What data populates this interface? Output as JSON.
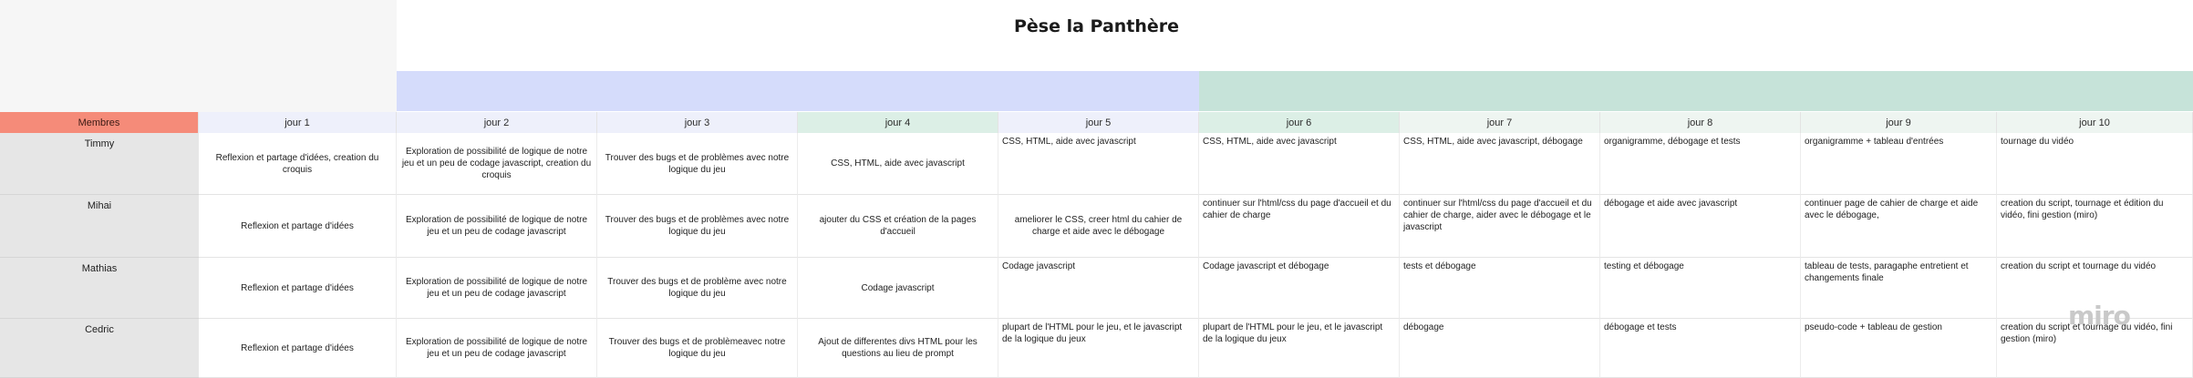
{
  "board": {
    "title": "Pèse la Panthère",
    "watermark": "miro"
  },
  "header": {
    "members_label": "Membres",
    "days": [
      "jour 1",
      "jour 2",
      "jour 3",
      "jour 4",
      "jour 5",
      "jour 6",
      "jour 7",
      "jour 8",
      "jour 9",
      "jour 10"
    ]
  },
  "colors": {
    "members_header": "#f58b79",
    "band_blue": "#d5dcfb",
    "band_green": "#c6e3d9"
  },
  "rows": [
    {
      "name": "Timmy",
      "cells": [
        "Reflexion et partage d'idées, creation du croquis",
        "Exploration de possibilité de logique de notre jeu et un peu de codage javascript, creation du croquis",
        "Trouver des bugs et de problèmes avec notre logique du jeu",
        "CSS, HTML, aide avec javascript",
        "CSS, HTML, aide avec javascript",
        "CSS, HTML, aide avec javascript",
        "CSS, HTML, aide avec javascript, débogage",
        "organigramme, débogage et tests",
        "organigramme + tableau d'entrées",
        "tournage du vidéo"
      ]
    },
    {
      "name": "Mihai",
      "cells": [
        "Reflexion et partage d'idées",
        "Exploration de possibilité de logique de notre jeu et un peu de codage javascript",
        "Trouver des bugs et de problèmes avec notre logique du jeu",
        "ajouter du CSS et création de la pages d'accueil",
        "ameliorer le CSS, creer html du cahier de charge et aide avec le débogage",
        "continuer sur l'html/css du page d'accueil et du cahier de charge",
        "continuer sur l'html/css du page d'accueil et du cahier de charge, aider avec le débogage et le javascript",
        "débogage et aide avec javascript",
        "continuer page de cahier de charge et aide avec le débogage,",
        "creation du script, tournage et édition du vidéo, fini gestion (miro)"
      ]
    },
    {
      "name": "Mathias",
      "cells": [
        "Reflexion et partage d'idées",
        "Exploration de possibilité de logique de notre jeu et un peu de codage javascript",
        "Trouver des bugs et de problème avec notre logique du jeu",
        "Codage javascript",
        "Codage javascript",
        "Codage javascript et débogage",
        "tests et débogage",
        "testing et débogage",
        "tableau de tests, paragaphe entretient et changements finale",
        "creation du script et tournage du vidéo"
      ]
    },
    {
      "name": "Cedric",
      "cells": [
        "Reflexion et partage d'idées",
        "Exploration de possibilité de logique de notre jeu et un peu de codage javascript",
        "Trouver des bugs et de problèmeavec notre logique du jeu",
        "Ajout de differentes divs HTML pour les questions au lieu de prompt",
        "plupart de l'HTML pour le jeu, et le javascript de la logique du jeux",
        "plupart de l'HTML pour le jeu, et le javascript de la logique du jeux",
        "débogage",
        "débogage et tests",
        "pseudo-code + tableau de gestion",
        "creation du script et tournage du vidéo, fini gestion (miro)"
      ]
    }
  ]
}
